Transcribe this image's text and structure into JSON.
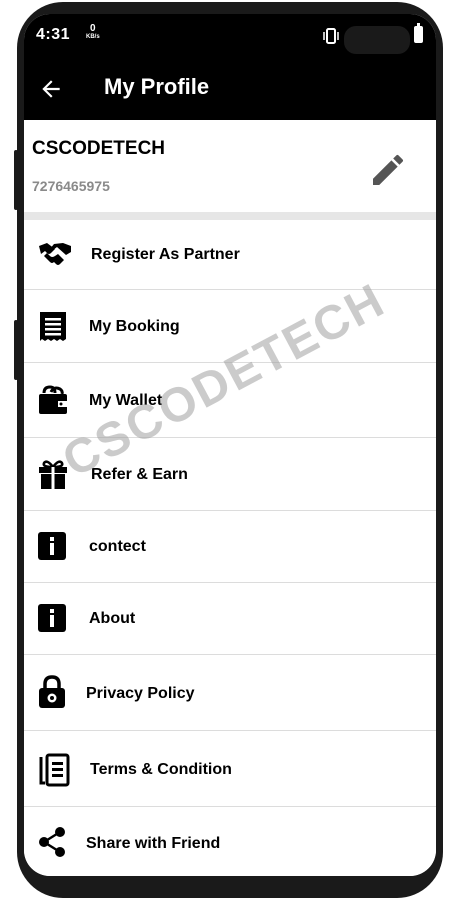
{
  "status_bar": {
    "time": "4:31",
    "net_speed_value": "0",
    "net_speed_unit": "KB/s"
  },
  "app_bar": {
    "title": "My Profile"
  },
  "profile": {
    "name": "CSCODETECH",
    "phone": "7276465975"
  },
  "menu": {
    "items": [
      {
        "label": "Register As Partner",
        "icon": "handshake-icon"
      },
      {
        "label": "My Booking",
        "icon": "receipt-icon"
      },
      {
        "label": "My Wallet",
        "icon": "wallet-icon"
      },
      {
        "label": "Refer & Earn",
        "icon": "gift-icon"
      },
      {
        "label": "contect",
        "icon": "info-icon"
      },
      {
        "label": "About",
        "icon": "info-icon"
      },
      {
        "label": "Privacy Policy",
        "icon": "lock-icon"
      },
      {
        "label": "Terms & Condition",
        "icon": "documents-icon"
      },
      {
        "label": "Share with Friend",
        "icon": "share-icon"
      }
    ]
  },
  "watermark": "CSCODETECH",
  "colors": {
    "app_bar": "#000000",
    "background": "#ffffff",
    "divider": "#dcdcdc",
    "phone_text": "#8a8a8a"
  }
}
